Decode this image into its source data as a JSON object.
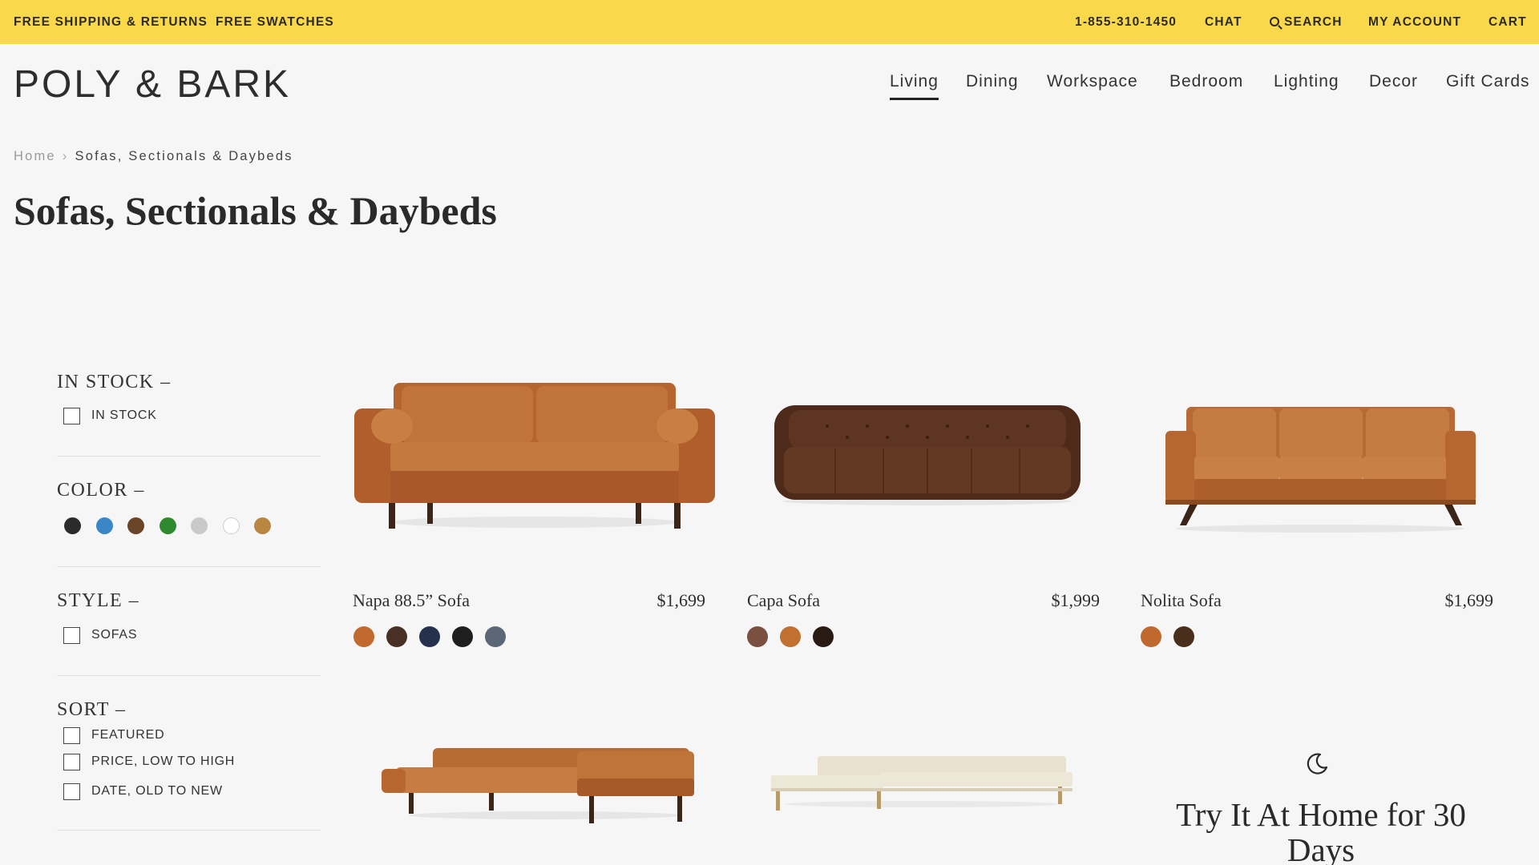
{
  "topbar": {
    "shipping": "FREE SHIPPING & RETURNS",
    "swatches": "FREE SWATCHES",
    "phone": "1-855-310-1450",
    "chat": "CHAT",
    "search": "SEARCH",
    "account": "MY ACCOUNT",
    "cart": "CART"
  },
  "logo": "POLY & BARK",
  "nav": [
    "Living",
    "Dining",
    "Workspace",
    "Bedroom",
    "Lighting",
    "Decor",
    "Gift Cards"
  ],
  "nav_active": "Living",
  "breadcrumb": {
    "home": "Home",
    "separator": "›",
    "current": "Sofas, Sectionals & Daybeds"
  },
  "page_title": "Sofas, Sectionals & Daybeds",
  "filters": {
    "in_stock": {
      "heading": "IN STOCK –",
      "options": [
        "IN STOCK"
      ]
    },
    "color": {
      "heading": "COLOR –",
      "swatches": [
        "#2b2b2b",
        "#3a86c6",
        "#6b4528",
        "#2f8a2f",
        "#c9c9c9",
        "#ffffff",
        "#b8863f"
      ]
    },
    "style": {
      "heading": "STYLE –",
      "options": [
        "SOFAS"
      ]
    },
    "sort": {
      "heading": "SORT –",
      "options": [
        "FEATURED",
        "PRICE, LOW TO HIGH",
        "DATE, OLD TO NEW"
      ]
    }
  },
  "products": [
    {
      "name": "Napa 88.5” Sofa",
      "price": "$1,699",
      "swatches": [
        "#c06a2f",
        "#4a3024",
        "#26324d",
        "#1f1f1f",
        "#5b6777"
      ]
    },
    {
      "name": "Capa Sofa",
      "price": "$1,999",
      "swatches": [
        "#7a5040",
        "#c0712f",
        "#2a1a14"
      ]
    },
    {
      "name": "Nolita Sofa",
      "price": "$1,699",
      "swatches": [
        "#c0692e",
        "#4a2e1c"
      ]
    }
  ],
  "promo": {
    "title": "Try It At Home for 30 Days",
    "icon": "moon-icon"
  }
}
